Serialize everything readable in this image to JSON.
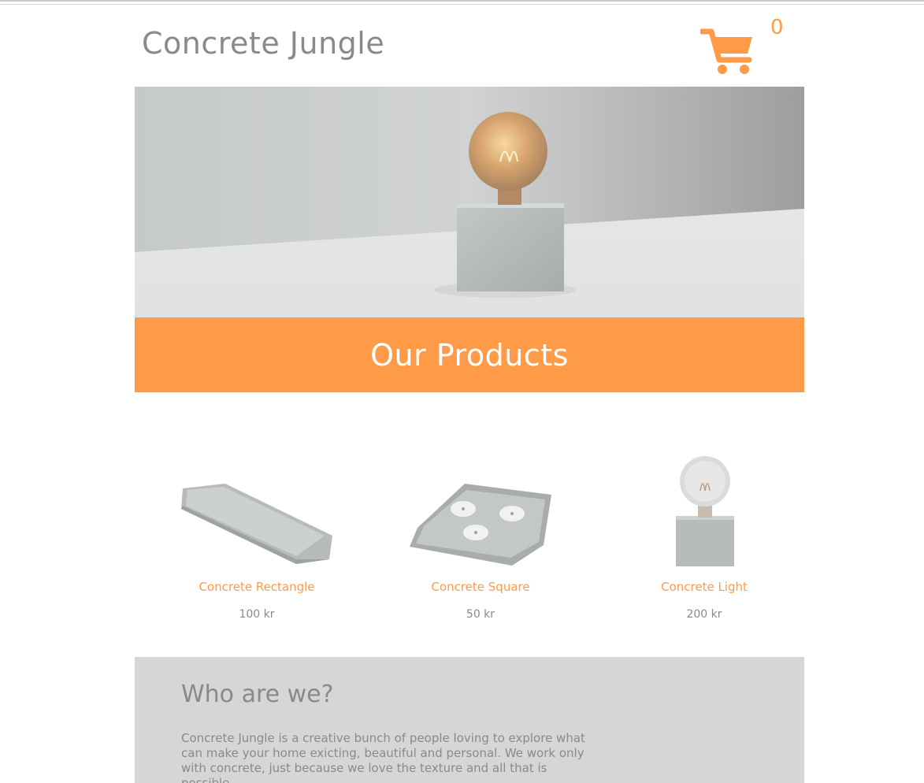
{
  "header": {
    "logo_text": "Concrete Jungle",
    "cart_icon": "shopping-cart-icon",
    "cart_count": "0"
  },
  "hero": {
    "image": "concrete-lamp-photo"
  },
  "banner": {
    "title": "Our Products"
  },
  "products": [
    {
      "name": "Concrete Rectangle",
      "price": "100 kr",
      "image": "concrete-rectangle-tray"
    },
    {
      "name": "Concrete Square",
      "price": "50 kr",
      "image": "concrete-square-candle-tray"
    },
    {
      "name": "Concrete Light",
      "price": "200 kr",
      "image": "concrete-light-lamp"
    }
  ],
  "about": {
    "title": "Who are we?",
    "text": "Concrete Jungle is a creative bunch of people loving to explore what can make your home exicting, beautiful and personal. We work only with concrete, just because we love the texture and all that is possible"
  },
  "colors": {
    "accent": "#ff9a48",
    "text_gray": "#8a8a8a",
    "about_bg": "#d4d6d7"
  }
}
